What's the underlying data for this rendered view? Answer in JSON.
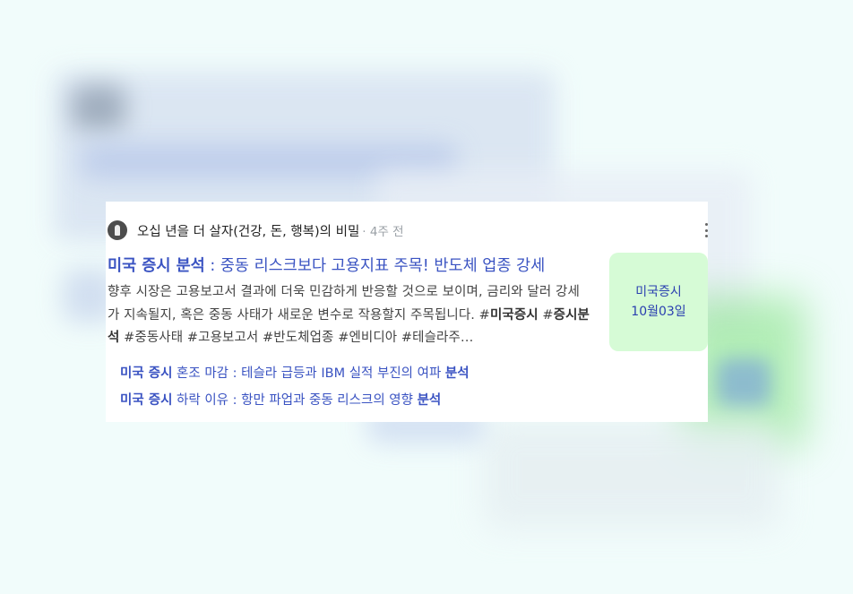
{
  "card": {
    "channel": "오십 년을 더 살자(건강, 돈, 행복)의 비밀",
    "time": "· 4주 전",
    "more_icon": "more-vertical-icon",
    "title_strong": "미국 증시 분석",
    "title_rest": " : 중동 리스크보다 고용지표 주목! 반도체 업종 강세",
    "desc_1": "향후 시장은 고용보고서 결과에 더욱 민감하게 반응할 것으로 보이며, 금리와 달러 강세가 지속될지, 혹은 중동 사태가 새로운 변수로 작용할지 주목됩니다. #",
    "desc_bold_1": "미국증시",
    "desc_2": " #",
    "desc_bold_2": "증시분석",
    "desc_3": " #중동사태 #고용보고서 #반도체업종 #엔비디아 #테슬라주…",
    "thumb_line1": "미국증시",
    "thumb_line2": "10월03일",
    "subs": [
      {
        "strong": "미국 증시",
        "text": " 혼조 마감 : 테슬라 급등과 IBM 실적 부진의 여파 ",
        "end": "분석"
      },
      {
        "strong": "미국 증시",
        "text": " 하락 이유 : 항만 파업과 중동 리스크의 영향 ",
        "end": "분석"
      }
    ]
  }
}
